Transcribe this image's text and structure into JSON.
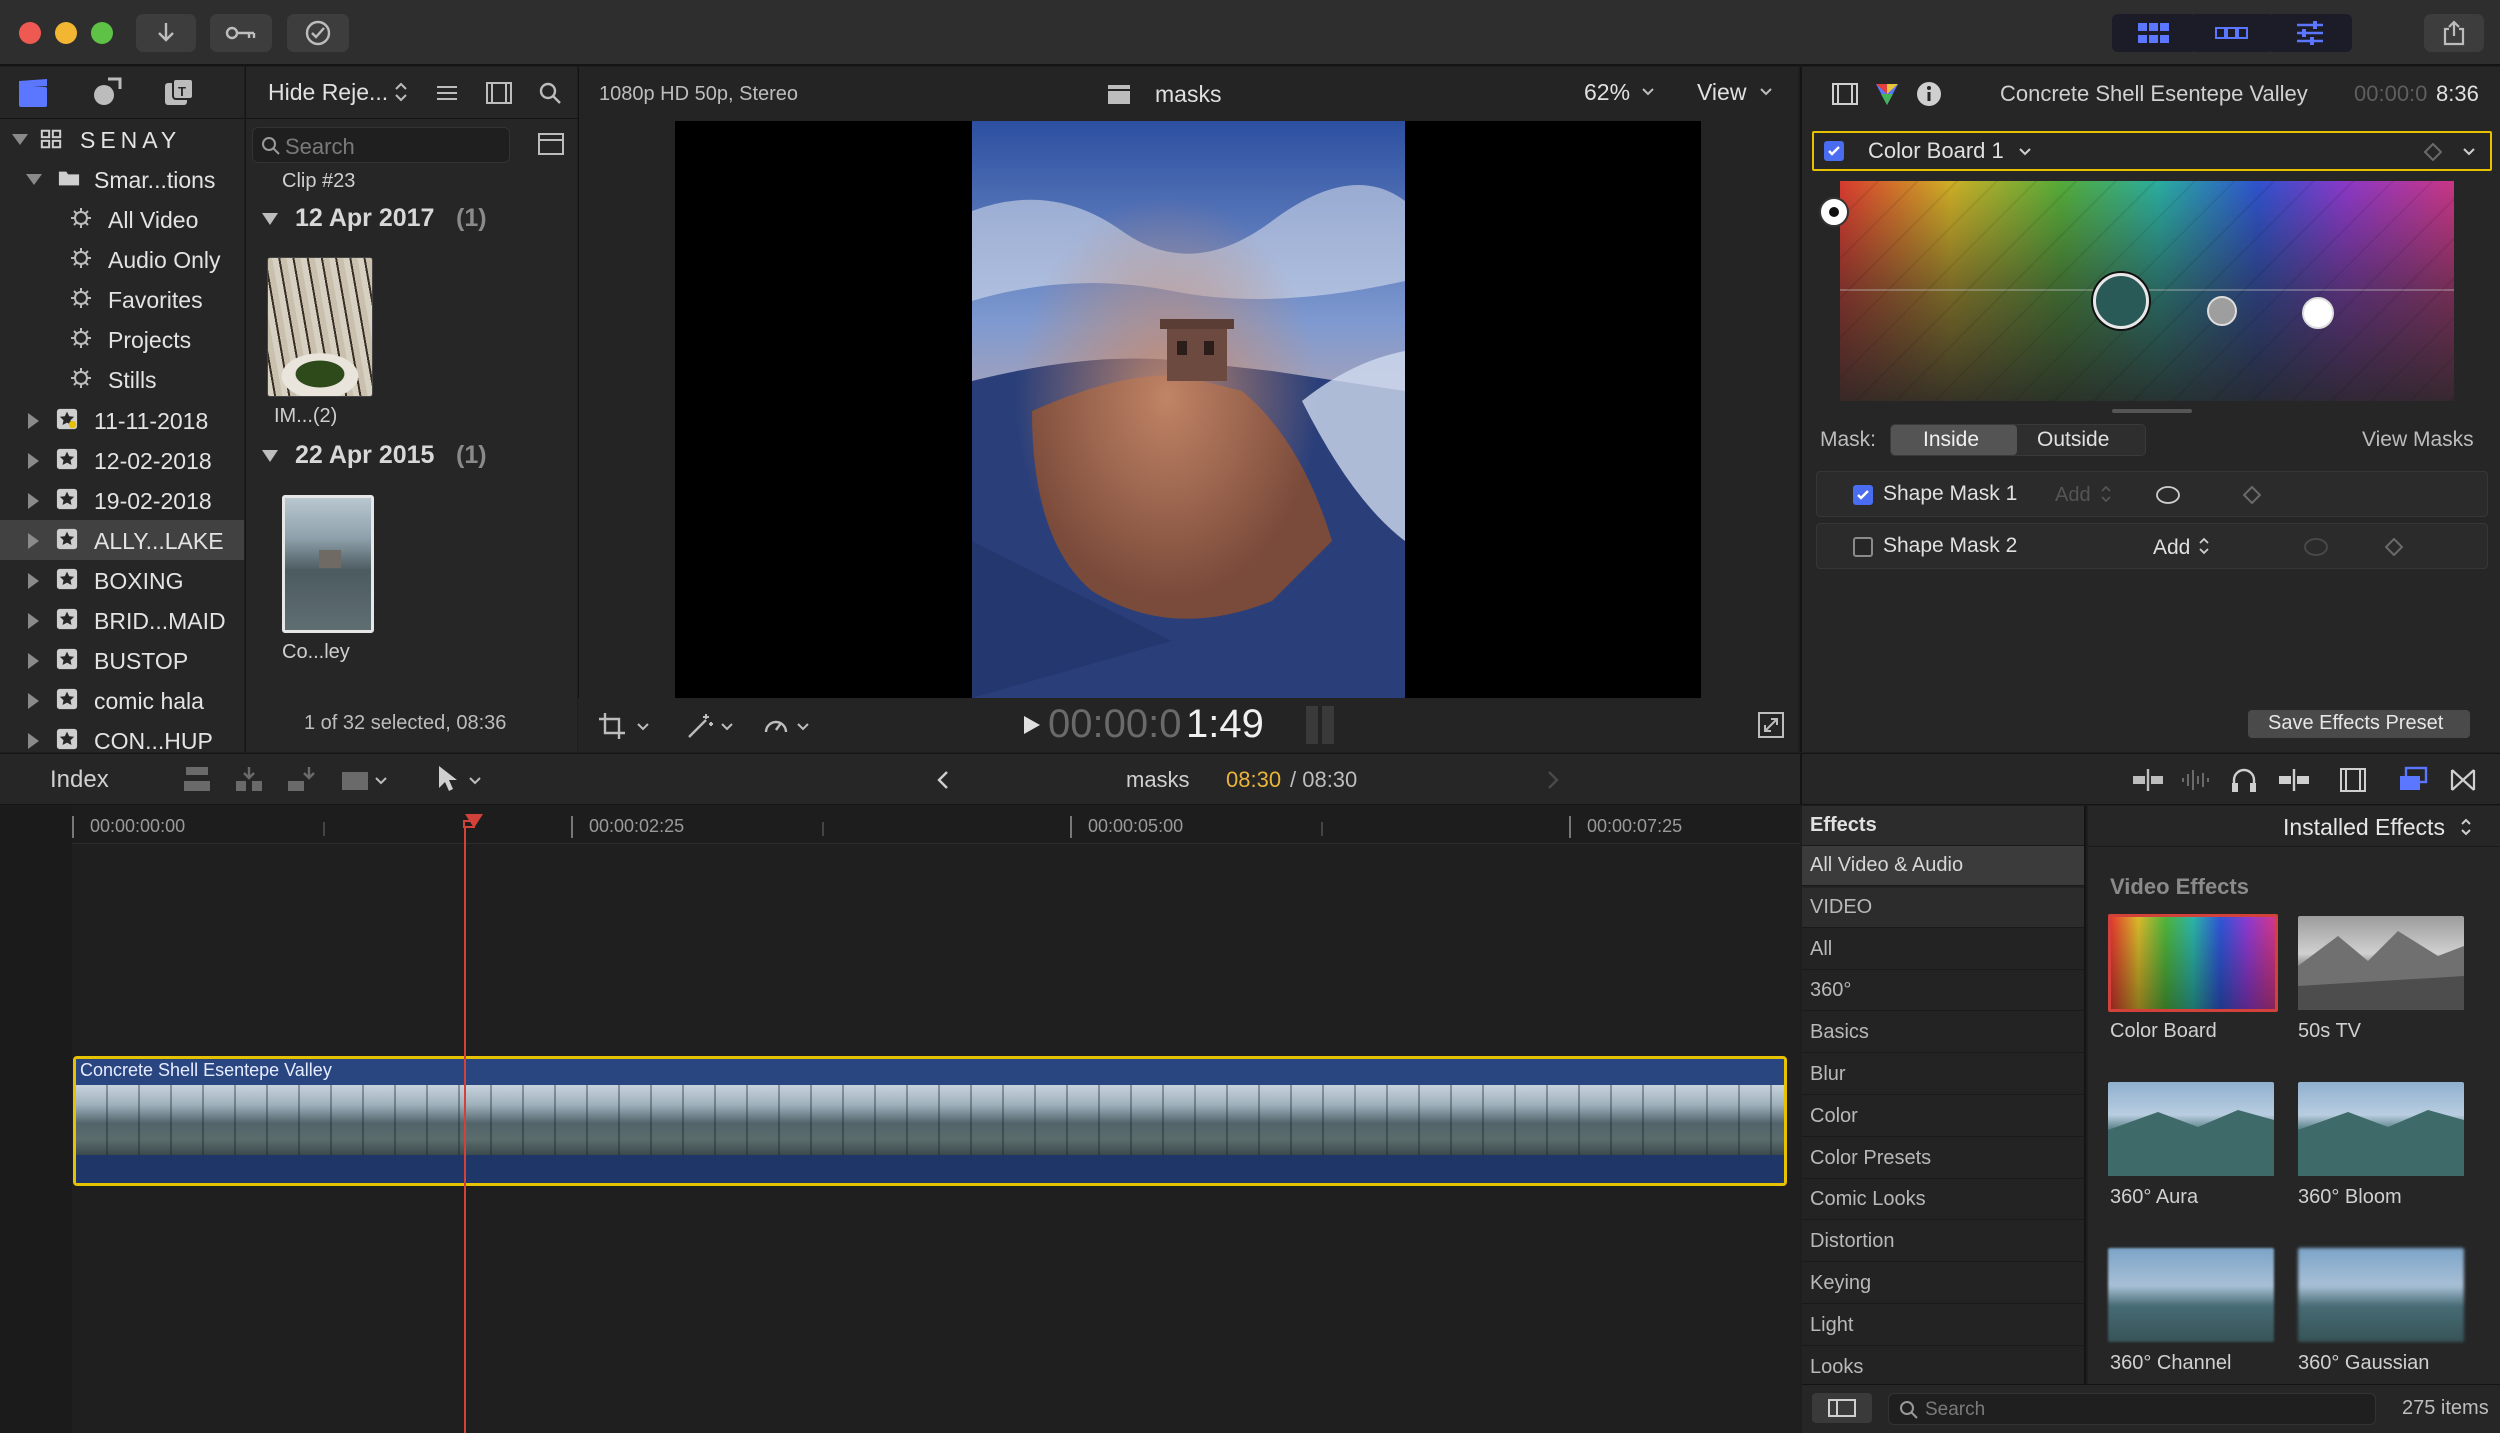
{
  "colors": {
    "accent_yellow": "#e6c200",
    "selection_blue": "#4a6cf0",
    "timecode_orange": "#e8b43a",
    "playhead_red": "#d2423a"
  },
  "toolbar": {
    "import_icon": "download-arrow-icon",
    "keywords_icon": "key-icon",
    "background_tasks_icon": "checkmark-circle-icon"
  },
  "library": {
    "name": "SENAY",
    "smart_folder": "Smar...tions",
    "smart_items": [
      "All Video",
      "Audio Only",
      "Favorites",
      "Projects",
      "Stills"
    ],
    "events": [
      "11-11-2018",
      "12-02-2018",
      "19-02-2018",
      "ALLY...LAKE",
      "BOXING",
      "BRID...MAID",
      "BUSTOP",
      "comic hala",
      "CON...HUP"
    ]
  },
  "browser": {
    "filter": "Hide Reje...",
    "search_placeholder": "Search",
    "clip_partial": "Clip #23",
    "group1_date": "12 Apr 2017",
    "group1_count": "(1)",
    "clip1_label": "IM...(2)",
    "group2_date": "22 Apr 2015",
    "group2_count": "(1)",
    "clip2_label": "Co...ley",
    "status": "1 of 32 selected, 08:36"
  },
  "viewer": {
    "format": "1080p HD 50p, Stereo",
    "project": "masks",
    "zoom": "62%",
    "view_menu": "View",
    "timecode_dim": "00:00:0",
    "timecode_bright": "1:49"
  },
  "inspector": {
    "clip_name": "Concrete Shell Esentepe Valley",
    "duration_dim": "00:00:0",
    "duration_bright": "8:36",
    "effect_name": "Color Board 1",
    "mask_label": "Mask:",
    "mask_inside": "Inside",
    "mask_outside": "Outside",
    "view_masks": "View Masks",
    "shape_mask_1": "Shape Mask 1",
    "shape_mask_2": "Shape Mask 2",
    "add_1": "Add",
    "add_2": "Add",
    "save_preset": "Save Effects Preset"
  },
  "timeline": {
    "index": "Index",
    "project": "masks",
    "position": "08:30",
    "duration": "/ 08:30",
    "ruler": [
      "00:00:00:00",
      "00:00:02:25",
      "00:00:05:00",
      "00:00:07:25"
    ],
    "clip_name": "Concrete Shell Esentepe Valley"
  },
  "effects": {
    "title": "Effects",
    "installed": "Installed Effects",
    "section": "Video Effects",
    "categories": [
      "All Video & Audio",
      "VIDEO",
      "All",
      "360°",
      "Basics",
      "Blur",
      "Color",
      "Color Presets",
      "Comic Looks",
      "Distortion",
      "Keying",
      "Light",
      "Looks"
    ],
    "items": [
      "Color Board",
      "50s TV",
      "360° Aura",
      "360° Bloom",
      "360° Channel",
      "360° Gaussian"
    ],
    "search_placeholder": "Search",
    "count": "275 items"
  }
}
